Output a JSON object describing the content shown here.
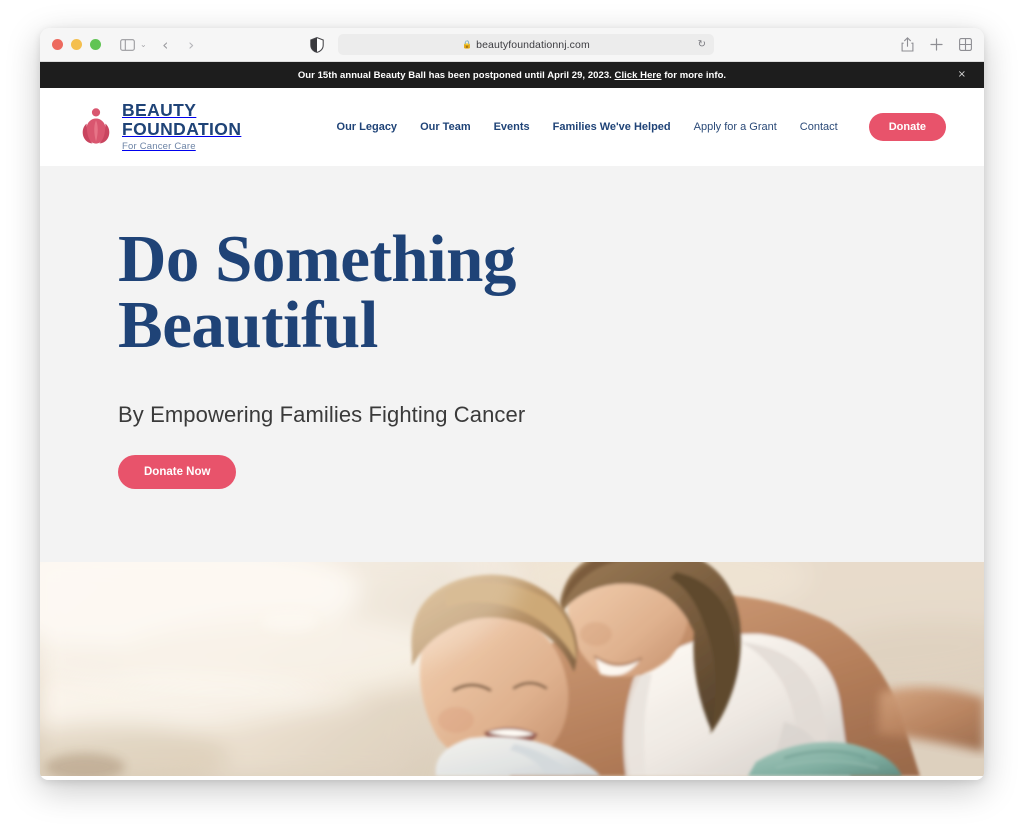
{
  "browser": {
    "url": "beautyfoundationnj.com",
    "lock_icon": "lock-icon",
    "reload_glyph": "↻",
    "back_glyph": "‹",
    "forward_glyph": "›",
    "sidebar_icon": "sidebar-icon",
    "chevron_glyph": "⌄",
    "shield_icon": "privacy-shield-icon",
    "share_icon": "share-icon",
    "new_tab_icon": "plus-icon",
    "tab_overview_icon": "tab-grid-icon",
    "traffic_lights": [
      "close",
      "minimize",
      "zoom"
    ]
  },
  "announcement": {
    "text_before": "Our 15th annual Beauty Ball has been postponed until April 29, 2023. ",
    "link_label": "Click Here",
    "text_after": " for more info.",
    "close_glyph": "×",
    "background": "#1d1d1d"
  },
  "header": {
    "logo": {
      "line1": "BEAUTY",
      "line2": "FOUNDATION",
      "tagline": "For Cancer Care",
      "mark_icon": "tulip-flower-icon",
      "mark_color": "#d9566f",
      "text_color": "#1f4377"
    },
    "nav": [
      {
        "label": "Our Legacy"
      },
      {
        "label": "Our Team"
      },
      {
        "label": "Events"
      },
      {
        "label": "Families We've Helped"
      },
      {
        "label": "Apply for a Grant"
      },
      {
        "label": "Contact"
      }
    ],
    "donate_label": "Donate"
  },
  "hero": {
    "title_line1": "Do Something",
    "title_line2": "Beautiful",
    "subtitle": "By Empowering Families Fighting Cancer",
    "cta_label": "Donate Now",
    "background": "#f3f3f3",
    "title_color": "#1f4377"
  },
  "photo": {
    "alt": "Mother and young son smiling together on a sunlit beach"
  },
  "theme": {
    "accent_pink": "#e8536b",
    "navy": "#1f4377",
    "hero_bg": "#f3f3f3",
    "announce_bg": "#1d1d1d"
  }
}
